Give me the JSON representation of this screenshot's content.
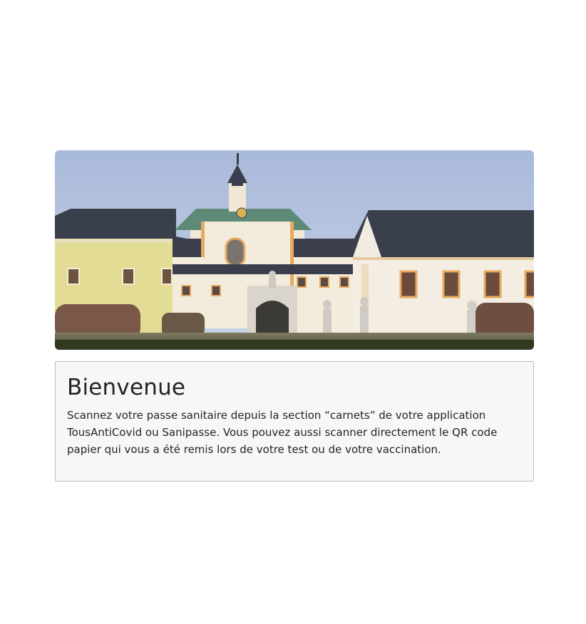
{
  "hero": {
    "alt": "Photo of a baroque château with statues in the garden"
  },
  "welcome": {
    "title": "Bienvenue",
    "text": "Scannez votre passe sanitaire depuis la section “carnets” de votre application TousAntiCovid ou Sanipasse. Vous pouvez aussi scanner directement le QR code papier qui vous a été remis lors de votre test ou de votre vaccination."
  }
}
